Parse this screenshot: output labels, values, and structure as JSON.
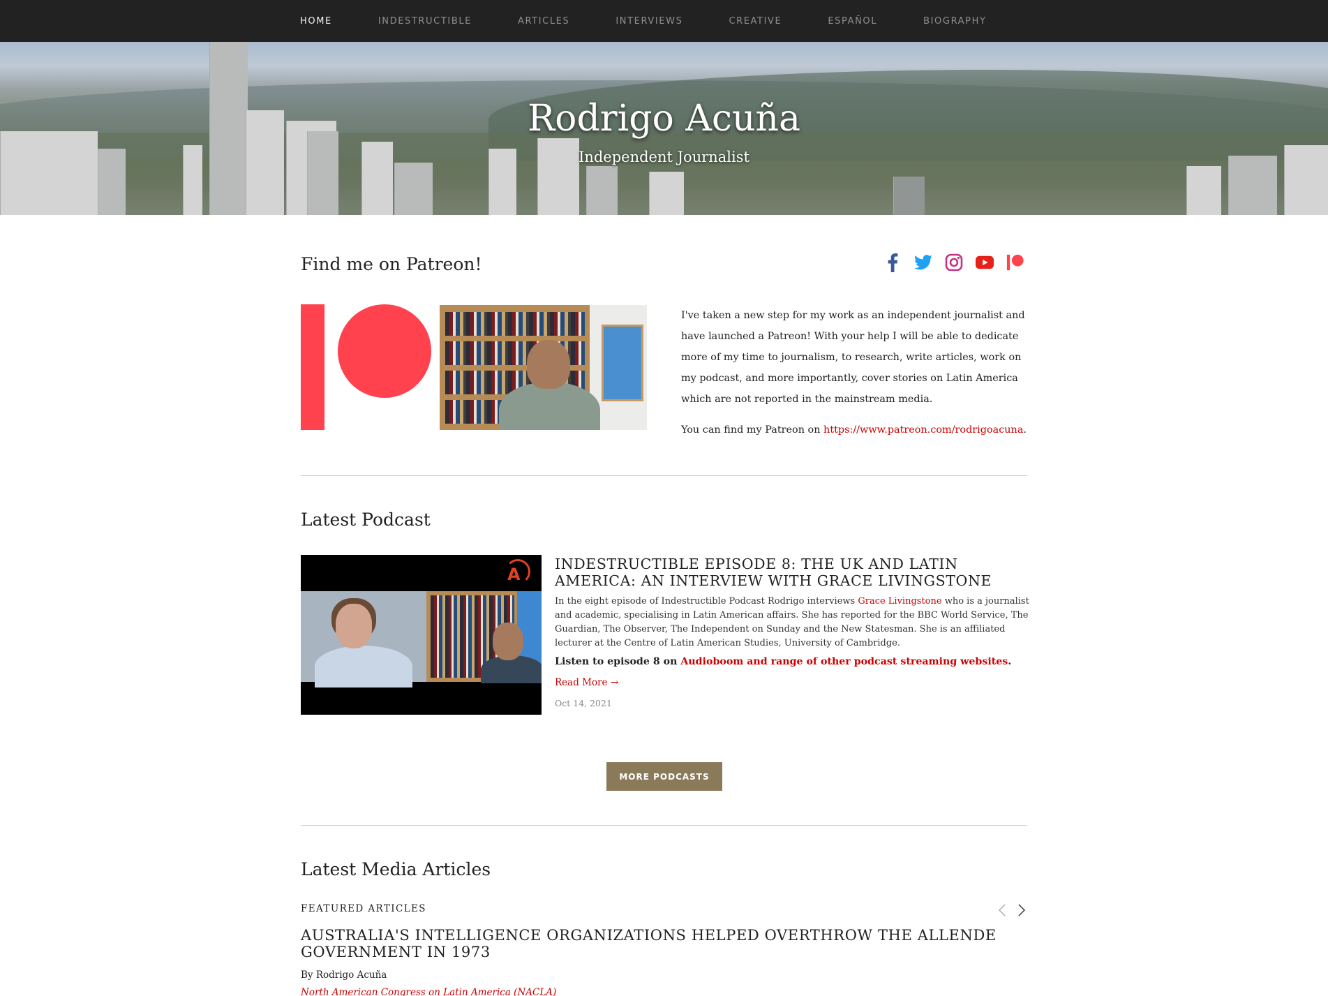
{
  "nav": {
    "items": [
      "HOME",
      "INDESTRUCTIBLE",
      "ARTICLES",
      "INTERVIEWS",
      "CREATIVE",
      "ESPAÑOL",
      "BIOGRAPHY"
    ]
  },
  "hero": {
    "title": "Rodrigo Acuña",
    "subtitle": "Independent Journalist"
  },
  "patreon_section": {
    "heading": "Find me on Patreon!",
    "paragraph": "I've taken a new step for my work as an independent journalist and have launched a Patreon! With your help I will be able to dedicate more of my time to journalism, to research, write articles, work on my podcast, and more importantly, cover stories on Latin America which are not reported in the mainstream media.",
    "find_prefix": "You can find my Patreon on ",
    "link_text": "https://www.patreon.com/rodrigoacuna",
    "find_suffix": "."
  },
  "social_icons": [
    "facebook-icon",
    "twitter-icon",
    "instagram-icon",
    "youtube-icon",
    "patreon-icon"
  ],
  "colors": {
    "nav_bg": "#222222",
    "accent_red": "#cc0000",
    "patreon_red": "#ff424d",
    "button_bg": "#8a7a59",
    "facebook": "#3b5998",
    "twitter": "#1da1f2",
    "instagram": "#c13584",
    "youtube": "#e62117"
  },
  "podcast": {
    "heading": "Latest Podcast",
    "title": "Indestructible Episode 8: The UK and Latin America: An Interview with Grace Livingstone",
    "desc_prefix": "In the eight episode of Indestructible Podcast Rodrigo interviews ",
    "desc_link": "Grace Livingstone",
    "desc_suffix": " who is a journalist and academic, specialising in Latin American affairs. She has reported for the BBC World Service, The Guardian, The Observer, The Independent on Sunday and the New Statesman. She is an affiliated lecturer at the Centre of Latin American Studies, University of Cambridge.",
    "listen_prefix": "Listen to episode 8 on ",
    "listen_link": "Audioboom and range of other podcast streaming websites",
    "listen_suffix": ".",
    "read_more": "Read More →",
    "date": "Oct 14, 2021",
    "thumb_logo_letter": "A",
    "more_button": "MORE PODCASTS"
  },
  "articles": {
    "heading": "Latest Media Articles",
    "featured_label": "FEATURED ARTICLES",
    "title": "Australia's Intelligence Organizations Helped Overthrow the Allende Government in 1973",
    "byline": "By Rodrigo Acuña",
    "source": "North American Congress on Latin America (NACLA)"
  }
}
